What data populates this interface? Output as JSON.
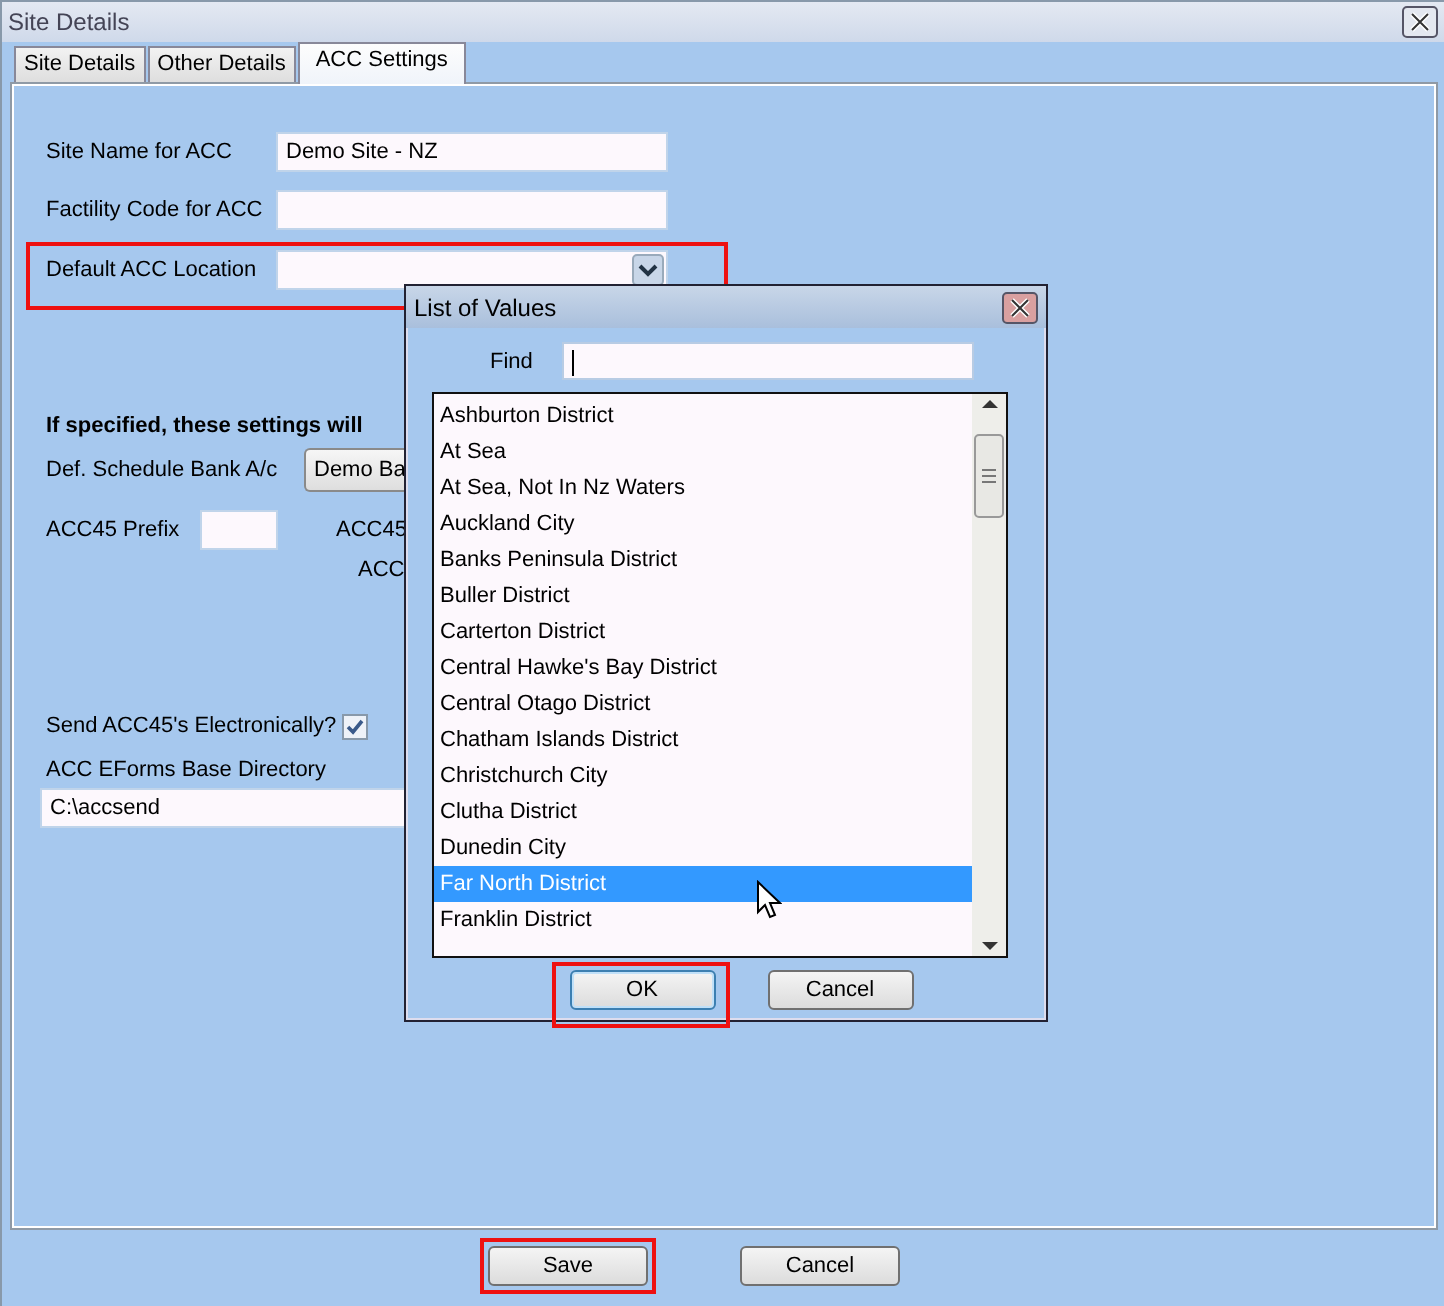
{
  "window": {
    "title": "Site Details"
  },
  "tabs": [
    {
      "label": "Site Details",
      "selected": false
    },
    {
      "label": "Other Details",
      "selected": false
    },
    {
      "label": "ACC Settings",
      "selected": true
    }
  ],
  "acc_fields": [
    {
      "label": "Site Name for ACC",
      "kind": "text",
      "value": "Demo Site - NZ",
      "highlighted": false
    },
    {
      "label": "Factility Code for ACC",
      "kind": "text",
      "highlighted": false
    },
    {
      "label": "Default ACC Location",
      "kind": "dropdown",
      "highlighted": true
    }
  ],
  "settings_note": "If specified, these settings will",
  "bank": {
    "label": "Def. Schedule Bank A/c",
    "value": "Demo Ba"
  },
  "prefix": {
    "label": "ACC45 Prefix"
  },
  "partial_labels": [
    "ACC45",
    "ACC"
  ],
  "send_electronically": {
    "label": "Send ACC45's Electronically?",
    "checked": true
  },
  "eforms": {
    "label": "ACC EForms Base Directory",
    "value": "C:\\accsend"
  },
  "buttons": [
    {
      "label": "Save",
      "highlighted": true
    },
    {
      "label": "Cancel",
      "highlighted": false
    }
  ],
  "dialog": {
    "title": "List of Values",
    "find_label": "Find",
    "items": [
      {
        "label": "Ashburton District",
        "selected": false
      },
      {
        "label": "At Sea",
        "selected": false
      },
      {
        "label": "At Sea, Not In Nz Waters",
        "selected": false
      },
      {
        "label": "Auckland City",
        "selected": false
      },
      {
        "label": "Banks Peninsula District",
        "selected": false
      },
      {
        "label": "Buller District",
        "selected": false
      },
      {
        "label": "Carterton District",
        "selected": false
      },
      {
        "label": "Central Hawke's Bay District",
        "selected": false
      },
      {
        "label": "Central Otago District",
        "selected": false
      },
      {
        "label": "Chatham Islands District",
        "selected": false
      },
      {
        "label": "Christchurch City",
        "selected": false
      },
      {
        "label": "Clutha District",
        "selected": false
      },
      {
        "label": "Dunedin City",
        "selected": false
      },
      {
        "label": "Far North District",
        "selected": true
      },
      {
        "label": "Franklin District",
        "selected": false
      }
    ],
    "buttons": [
      {
        "label": "OK",
        "highlighted": true
      },
      {
        "label": "Cancel",
        "highlighted": false
      }
    ]
  }
}
